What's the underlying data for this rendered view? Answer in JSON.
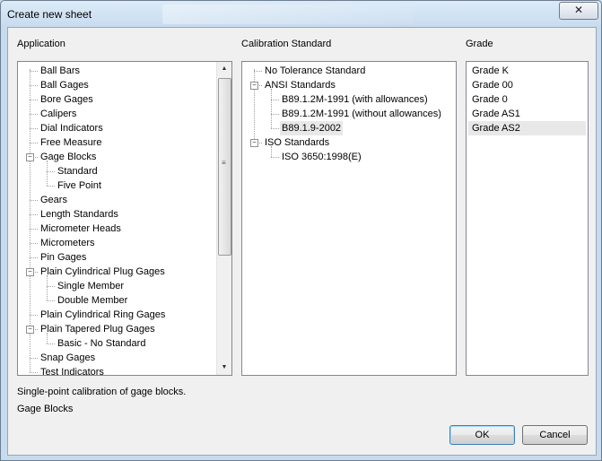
{
  "window": {
    "title": "Create new sheet",
    "close_glyph": "✕"
  },
  "application": {
    "label": "Application",
    "items": [
      {
        "label": "Ball Bars",
        "level": 0,
        "expander": ""
      },
      {
        "label": "Ball Gages",
        "level": 0,
        "expander": ""
      },
      {
        "label": "Bore Gages",
        "level": 0,
        "expander": ""
      },
      {
        "label": "Calipers",
        "level": 0,
        "expander": ""
      },
      {
        "label": "Dial Indicators",
        "level": 0,
        "expander": ""
      },
      {
        "label": "Free Measure",
        "level": 0,
        "expander": ""
      },
      {
        "label": "Gage Blocks",
        "level": 0,
        "expander": "−"
      },
      {
        "label": "Standard",
        "level": 1,
        "expander": ""
      },
      {
        "label": "Five Point",
        "level": 1,
        "expander": ""
      },
      {
        "label": "Gears",
        "level": 0,
        "expander": ""
      },
      {
        "label": "Length Standards",
        "level": 0,
        "expander": ""
      },
      {
        "label": "Micrometer Heads",
        "level": 0,
        "expander": ""
      },
      {
        "label": "Micrometers",
        "level": 0,
        "expander": ""
      },
      {
        "label": "Pin Gages",
        "level": 0,
        "expander": ""
      },
      {
        "label": "Plain Cylindrical Plug Gages",
        "level": 0,
        "expander": "−"
      },
      {
        "label": "Single Member",
        "level": 1,
        "expander": ""
      },
      {
        "label": "Double Member",
        "level": 1,
        "expander": ""
      },
      {
        "label": "Plain Cylindrical Ring Gages",
        "level": 0,
        "expander": ""
      },
      {
        "label": "Plain Tapered Plug Gages",
        "level": 0,
        "expander": "−"
      },
      {
        "label": "Basic - No Standard",
        "level": 1,
        "expander": ""
      },
      {
        "label": "Snap Gages",
        "level": 0,
        "expander": ""
      },
      {
        "label": "Test Indicators",
        "level": 0,
        "expander": ""
      }
    ]
  },
  "calibration": {
    "label": "Calibration Standard",
    "items": [
      {
        "label": "No Tolerance Standard",
        "level": 0,
        "expander": ""
      },
      {
        "label": "ANSI Standards",
        "level": 0,
        "expander": "−"
      },
      {
        "label": "B89.1.2M-1991 (with allowances)",
        "level": 1,
        "expander": ""
      },
      {
        "label": "B89.1.2M-1991 (without allowances)",
        "level": 1,
        "expander": ""
      },
      {
        "label": "B89.1.9-2002",
        "level": 1,
        "expander": "",
        "selected": true
      },
      {
        "label": "ISO Standards",
        "level": 0,
        "expander": "−"
      },
      {
        "label": "ISO 3650:1998(E)",
        "level": 1,
        "expander": ""
      }
    ]
  },
  "grade": {
    "label": "Grade",
    "items": [
      "Grade K",
      "Grade 00",
      "Grade 0",
      "Grade AS1",
      "Grade AS2"
    ],
    "selected_index": 4
  },
  "description": "Single-point calibration of gage blocks.",
  "selected_application": "Gage Blocks",
  "buttons": {
    "ok": "OK",
    "cancel": "Cancel"
  },
  "scrollbar": {
    "up_glyph": "▲",
    "down_glyph": "▼",
    "grip_glyph": "≡"
  }
}
